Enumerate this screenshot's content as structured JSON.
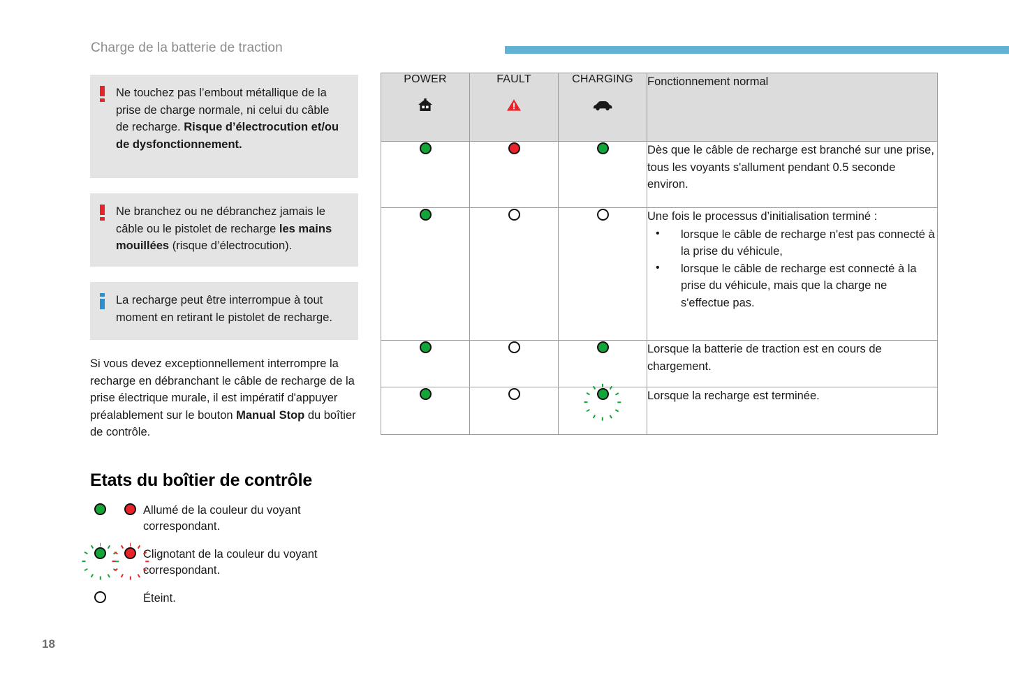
{
  "header": {
    "title": "Charge de la batterie de traction",
    "rule_color": "#62b2d4"
  },
  "left_column": {
    "callouts": [
      {
        "icon": "warning-exclamation-icon",
        "icon_color": "#e8232a",
        "text_html": "Ne touchez pas l’embout métallique de la prise de charge normale, ni celui du câble de recharge. <b>Risque d’électrocution et/ou de dysfonctionnement.</b>",
        "text_plain": "Ne touchez pas l’embout métallique de la prise de charge normale, ni celui du câble de recharge. Risque d’électrocution et/ou de dysfonctionnement."
      },
      {
        "icon": "warning-exclamation-icon",
        "icon_color": "#e8232a",
        "text_html": "Ne branchez ou ne débranchez jamais le câble ou le pistolet de recharge <b>les mains mouillées</b> (risque d’électrocution).",
        "text_plain": "Ne branchez ou ne débranchez jamais le câble ou le pistolet de recharge les mains mouillées (risque d’électrocution)."
      },
      {
        "icon": "info-i-icon",
        "icon_color": "#2b8fd0",
        "text_html": "La recharge peut être interrompue à tout moment en retirant le pistolet de recharge.",
        "text_plain": "La recharge peut être interrompue à tout moment en retirant le pistolet de recharge."
      }
    ],
    "paragraph_html": "Si vous devez exceptionnellement interrompre la recharge en débranchant le câble de recharge de la prise électrique murale, il est impératif d'appuyer préalablement sur le bouton <b>Manual Stop</b> du boîtier de contrôle.",
    "paragraph_plain": "Si vous devez exceptionnellement interrompre la recharge en débranchant le câble de recharge de la prise électrique murale, il est impératif d'appuyer préalablement sur le bouton Manual Stop du boîtier de contrôle.",
    "section_title": "Etats du boîtier de contrôle",
    "legend": [
      {
        "states": [
          "green-on",
          "red-on"
        ],
        "text": "Allumé de la couleur du voyant correspondant."
      },
      {
        "states": [
          "green-blink",
          "red-blink"
        ],
        "text": "Clignotant de la couleur du voyant correspondant."
      },
      {
        "states": [
          "off"
        ],
        "text": "Éteint."
      }
    ]
  },
  "table": {
    "columns": [
      {
        "label": "POWER",
        "icon": "house-icon",
        "icon_color": "#1a1a1a"
      },
      {
        "label": "FAULT",
        "icon": "warning-triangle-icon",
        "icon_color": "#e8232a"
      },
      {
        "label": "CHARGING",
        "icon": "car-icon",
        "icon_color": "#1a1a1a"
      }
    ],
    "header_description": "Fonctionnement normal",
    "rows": [
      {
        "power": "green-on",
        "fault": "red-on",
        "charging": "green-on",
        "description": "Dès que le câble de recharge est branché sur une prise, tous les voyants s'allument pendant 0.5 seconde environ."
      },
      {
        "power": "green-on",
        "fault": "off",
        "charging": "off",
        "lead": "Une fois le processus d’initialisation terminé :",
        "bullets": [
          "lorsque le câble de recharge n'est pas connecté à la prise du véhicule,",
          "lorsque le câble de recharge est connecté à la prise du véhicule, mais que la charge ne s'effectue pas."
        ]
      },
      {
        "power": "green-on",
        "fault": "off",
        "charging": "green-on",
        "description": "Lorsque la batterie de traction est en cours de chargement."
      },
      {
        "power": "green-on",
        "fault": "off",
        "charging": "green-blink",
        "description": "Lorsque la recharge est terminée."
      }
    ]
  },
  "footer": {
    "page_number": "18"
  },
  "colors": {
    "led_green": "#13a538",
    "led_red": "#e8232a",
    "led_outline": "#111111",
    "callout_bg": "#e4e4e4",
    "table_header_bg": "#dcdcdc",
    "table_border": "#9b9b9b",
    "header_text": "#8c8c8c"
  }
}
